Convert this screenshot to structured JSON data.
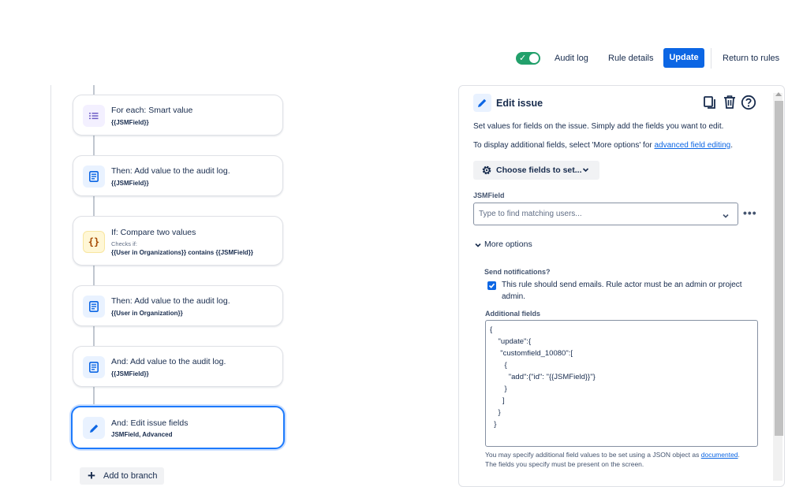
{
  "topbar": {
    "toggle_enabled": true,
    "audit_log": "Audit log",
    "rule_details": "Rule details",
    "update": "Update",
    "return_to_rules": "Return to rules"
  },
  "flow": {
    "cards": [
      {
        "title": "For each: Smart value",
        "sub": "{{JSMField}}",
        "icon": "list-icon"
      },
      {
        "title": "Then: Add value to the audit log.",
        "sub": "{{JSMField}}",
        "icon": "document-icon"
      },
      {
        "title": "If: Compare two values",
        "small": "Checks if:",
        "sub": "{{User in Organizations}} contains {{JSMField}}",
        "icon": "braces-icon"
      },
      {
        "title": "Then: Add value to the audit log.",
        "sub": "{{User in Organization}}",
        "icon": "document-icon"
      },
      {
        "title": "And: Add value to the audit log.",
        "sub": "{{JSMField}}",
        "icon": "document-icon"
      },
      {
        "title": "And: Edit issue fields",
        "sub": "JSMField, Advanced",
        "icon": "pencil-icon"
      }
    ],
    "add_branch": "Add to branch"
  },
  "panel": {
    "title": "Edit issue",
    "desc1": "Set values for fields on the issue. Simply add the fields you want to edit.",
    "desc2_prefix": "To display additional fields, select 'More options' for ",
    "desc2_link": "advanced field editing",
    "desc2_suffix": ".",
    "choose_fields": "Choose fields to set...",
    "jsm_label": "JSMField",
    "jsm_placeholder": "Type to find matching users...",
    "more_options": "More options",
    "send_notif_label": "Send notifications?",
    "send_notif_text_1": "This rule should send emails. Rule actor must be an admin or project",
    "send_notif_text_2": "admin.",
    "send_notif_checked": true,
    "additional_label": "Additional fields",
    "json": "{\n    \"update\":{\n     \"customfield_10080\":[\n       {\n         \"add\":{\"id\": \"{{JSMField}}\"}\n       }\n      ]\n    }\n  }",
    "help_prefix": "You may specify additional field values to be set using a JSON object as ",
    "help_link": "documented",
    "help_suffix": ".",
    "help2": "The fields you specify must be present on the screen."
  },
  "colors": {
    "primary": "#0c66e4",
    "toggle_on": "#22a06b",
    "selected_border": "#1d7afc"
  }
}
